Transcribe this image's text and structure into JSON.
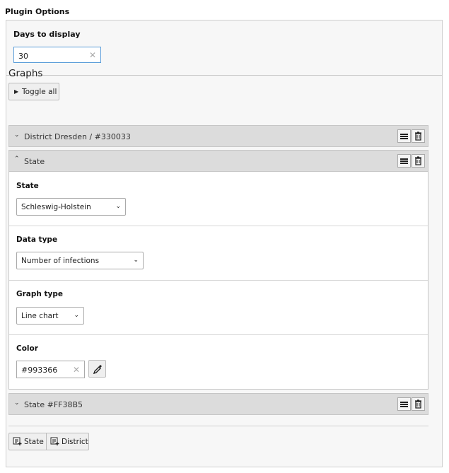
{
  "title": "Plugin Options",
  "days": {
    "label": "Days to display",
    "value": "30"
  },
  "graphs_title": "Graphs",
  "toggle_all_label": "Toggle all",
  "items": [
    {
      "title": "District Dresden / #330033",
      "expanded": false
    },
    {
      "title": "State",
      "expanded": true
    },
    {
      "title": "State #FF38B5",
      "expanded": false
    }
  ],
  "form": {
    "state": {
      "label": "State",
      "value": "Schleswig-Holstein"
    },
    "data_type": {
      "label": "Data type",
      "value": "Number of infections"
    },
    "graph_type": {
      "label": "Graph type",
      "value": "Line chart"
    },
    "color": {
      "label": "Color",
      "value": "#993366"
    }
  },
  "add_buttons": {
    "state": "State",
    "district": "District"
  },
  "icons": [
    "chevron-down-icon",
    "chevron-up-icon",
    "drag-handle-icon",
    "trash-icon",
    "clear-icon",
    "eyedropper-icon",
    "add-record-icon"
  ]
}
